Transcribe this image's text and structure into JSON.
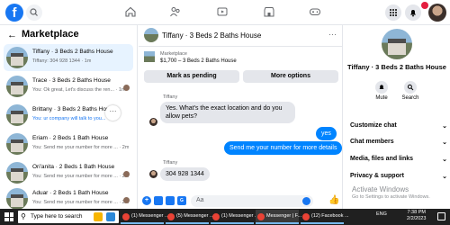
{
  "topbar": {
    "logo": "f",
    "accent": "#1877f2"
  },
  "left": {
    "title": "Marketplace",
    "chats": [
      {
        "name": "Tiffany · 3 Beds 2 Baths House",
        "last": "Tiffany: 304 928 1344 · 1m",
        "active": true,
        "blue": false
      },
      {
        "name": "Trace · 3 Beds 2 Baths House",
        "last": "You: Ok great, Let's discuss the ren... · 1m",
        "active": false,
        "blue": false
      },
      {
        "name": "Brittany · 3 Beds 2 Baths House",
        "last": "You: ur company will talk to you...",
        "active": false,
        "blue": false
      },
      {
        "name": "Eriam · 2 Beds 1 Bath House",
        "last": "You: Send me your number for more ... · 2m",
        "active": false,
        "blue": false
      },
      {
        "name": "Ori'anita · 2 Beds 1 Bath House",
        "last": "You: Send me your number for more ... · 2m",
        "active": false,
        "blue": false
      },
      {
        "name": "Aduar · 2 Beds 1 Bath House",
        "last": "You: Send me your number for more ... · 2m",
        "active": false,
        "blue": false
      }
    ]
  },
  "center": {
    "title": "Tiffany · 3 Beds 2 Baths House",
    "listing_label": "Marketplace",
    "listing_info": "$1,700 – 3 Beds 2 Baths House",
    "mark_pending": "Mark as pending",
    "more_options": "More options",
    "sender_1": "Tiffany",
    "msg_1": "Yes. What's the exact location and do you allow pets?",
    "reply_1": "yes",
    "reply_2": "Send me your number for more details",
    "sender_2": "Tiffany",
    "msg_2": "304 928 1344",
    "composer_placeholder": "Aa"
  },
  "right": {
    "title": "Tiffany · 3 Beds 2 Baths House",
    "mute": "Mute",
    "search": "Search",
    "rows": [
      "Customize chat",
      "Chat members",
      "Media, files and links",
      "Privacy & support"
    ],
    "activate_title": "Activate Windows",
    "activate_sub": "Go to Settings to activate Windows."
  },
  "taskbar": {
    "search_placeholder": "Type here to search",
    "apps": [
      "(1) Messenger ...",
      "(5) Messenger ...",
      "(1) Messenger ...",
      "Messenger | F...",
      "(12) Facebook ..."
    ],
    "tray_lang": "ENG",
    "time": "7:38 PM",
    "date": "2/2/2023"
  }
}
